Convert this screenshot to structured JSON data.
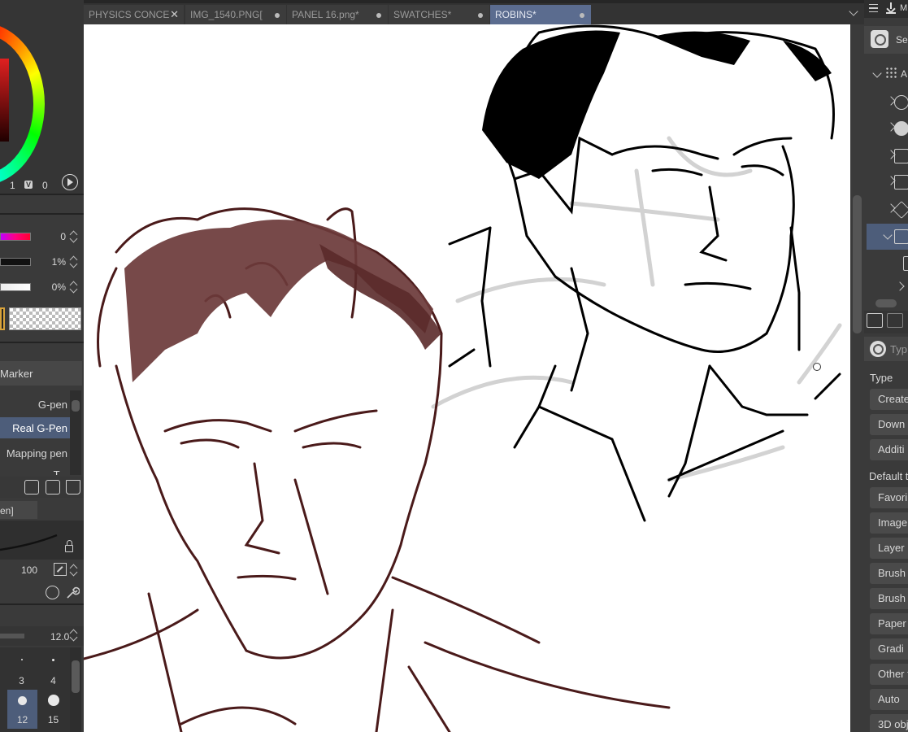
{
  "color_panel": {
    "hsv_values": [
      "1",
      "V",
      "0"
    ],
    "sliders": [
      {
        "value": "0"
      },
      {
        "value": "1%"
      },
      {
        "value": "0%"
      }
    ]
  },
  "subtool": {
    "group_label": "Marker",
    "items": [
      "G-pen",
      "Real G-Pen",
      "Mapping pen",
      "T..."
    ],
    "selected": "Real G-Pen",
    "tab_label": "en]"
  },
  "tool_property": {
    "size_value": "100",
    "bar_value": "12.0"
  },
  "brush_size_grid": [
    {
      "label": "3",
      "selected": false
    },
    {
      "label": "4",
      "selected": false
    },
    {
      "label": "12",
      "selected": true
    },
    {
      "label": "15",
      "selected": false
    }
  ],
  "tabs": [
    {
      "label": "PHYSICS CONCE",
      "status": "close"
    },
    {
      "label": "IMG_1540.PNG[",
      "status": "dot"
    },
    {
      "label": "PANEL 16.png*",
      "status": "dot"
    },
    {
      "label": "SWATCHES*",
      "status": "dot"
    },
    {
      "label": "ROBINS*",
      "status": "dot",
      "active": true
    }
  ],
  "right_panel": {
    "header_label": "M",
    "search_label": "Sea",
    "tree_root_label": "A",
    "type_search_placeholder": "Typ",
    "type_heading": "Type",
    "type_buttons": [
      "Create",
      "Down",
      "Additi"
    ],
    "default_heading": "Default t",
    "default_buttons": [
      "Favori",
      "Image",
      "Layer",
      "Brush t",
      "Brush",
      "Paper",
      "Gradi",
      "Other t",
      "Auto",
      "3D obj"
    ]
  },
  "colors": {
    "accent_selection": "#4d5d7a",
    "active_tab": "#5b6c8f",
    "sketch_brown": "#4a1a1a",
    "sketch_black": "#000000"
  }
}
